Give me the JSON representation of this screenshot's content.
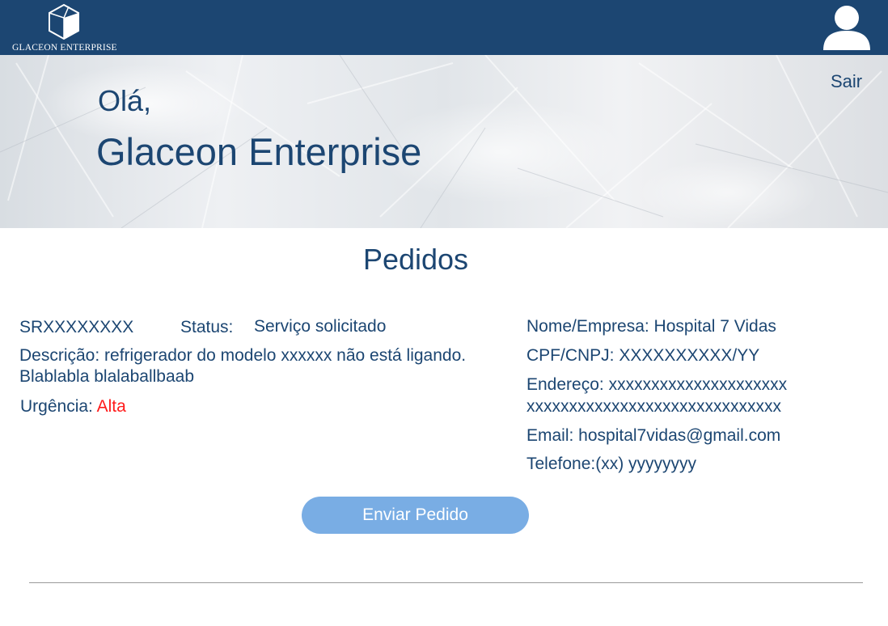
{
  "header": {
    "logo_text": "GLACEON ENTERPRISE",
    "avatar_icon": "user-avatar-icon",
    "background_color": "#1c4672"
  },
  "hero": {
    "greeting": "Olá,",
    "company_name": "Glaceon Enterprise",
    "logout_label": "Sair"
  },
  "section_title": "Pedidos",
  "order": {
    "id": "SRXXXXXXXX",
    "status_label": "Status:",
    "status_value": "Serviço solicitado",
    "description": "Descrição: refrigerador do modelo xxxxxx não está ligando. Blablabla blalaballbaab",
    "urgency_label": "Urgência:",
    "urgency_value": "Alta",
    "urgency_color": "#ff1a1a"
  },
  "client": {
    "name": "Nome/Empresa: Hospital 7 Vidas",
    "document": "CPF/CNPJ: XXXXXXXXXX/YY",
    "address_line1": "Endereço: xxxxxxxxxxxxxxxxxxxxx",
    "address_line2": "xxxxxxxxxxxxxxxxxxxxxxxxxxxxxx",
    "email": "Email: hospital7vidas@gmail.com",
    "phone": "Telefone:(xx) yyyyyyyy"
  },
  "actions": {
    "send_label": "Enviar Pedido",
    "send_color": "#79ade4"
  },
  "colors": {
    "primary": "#1c4672",
    "accent": "#79ade4",
    "alert": "#ff1a1a"
  }
}
